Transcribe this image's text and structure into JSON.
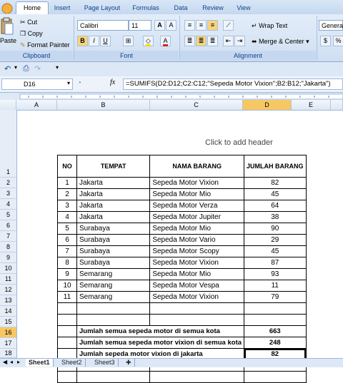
{
  "ribbon": {
    "tabs": [
      "Home",
      "Insert",
      "Page Layout",
      "Formulas",
      "Data",
      "Review",
      "View"
    ],
    "active_tab": "Home",
    "clipboard": {
      "paste": "Paste",
      "cut": "Cut",
      "copy": "Copy",
      "format_painter": "Format Painter",
      "label": "Clipboard"
    },
    "font": {
      "name": "Calibri",
      "size": "11",
      "label": "Font"
    },
    "alignment": {
      "wrap_text": "Wrap Text",
      "merge_center": "Merge & Center",
      "label": "Alignment"
    },
    "number": {
      "format": "General"
    }
  },
  "formula_bar": {
    "cell_ref": "D16",
    "fx": "fx",
    "formula": "=SUMIFS(D2:D12;C2:C12;\"Sepeda Motor Vixion\";B2:B12;\"Jakarta\")"
  },
  "columns": [
    "A",
    "B",
    "C",
    "D",
    "E"
  ],
  "selected_column": "D",
  "rows": [
    "1",
    "2",
    "3",
    "4",
    "5",
    "6",
    "7",
    "8",
    "9",
    "10",
    "11",
    "12",
    "13",
    "14",
    "15",
    "16",
    "17",
    "18"
  ],
  "selected_row": "16",
  "page_header_placeholder": "Click to add header",
  "table": {
    "headers": [
      "NO",
      "TEMPAT",
      "NAMA BARANG",
      "JUMLAH BARANG"
    ],
    "rows": [
      [
        "1",
        "Jakarta",
        "Sepeda Motor Vixion",
        "82"
      ],
      [
        "2",
        "Jakarta",
        "Sepeda Motor Mio",
        "45"
      ],
      [
        "3",
        "Jakarta",
        "Sepeda Motor Verza",
        "64"
      ],
      [
        "4",
        "Jakarta",
        "Sepeda Motor Jupiter",
        "38"
      ],
      [
        "5",
        "Surabaya",
        "Sepeda Motor Mio",
        "90"
      ],
      [
        "6",
        "Surabaya",
        "Sepeda Motor Vario",
        "29"
      ],
      [
        "7",
        "Surabaya",
        "Sepeda Motor Scopy",
        "45"
      ],
      [
        "8",
        "Surabaya",
        "Sepeda Motor Vixion",
        "87"
      ],
      [
        "9",
        "Semarang",
        "Sepeda Motor Mio",
        "93"
      ],
      [
        "10",
        "Semarang",
        "Sepeda Motor Vespa",
        "11"
      ],
      [
        "11",
        "Semarang",
        "Sepeda Motor Vixion",
        "79"
      ]
    ],
    "summary": [
      {
        "label": "Jumlah semua sepeda motor di semua kota",
        "value": "663"
      },
      {
        "label": "Jumlah semua sepeda motor vixion di semua kota",
        "value": "248"
      },
      {
        "label": "Jumlah sepeda motor vixion di jakarta",
        "value": "82"
      }
    ]
  },
  "sheets": [
    "Sheet1",
    "Sheet2",
    "Sheet3"
  ],
  "active_sheet": "Sheet1",
  "colors": {
    "accent": "#15428b",
    "selected_header": "#f6c763",
    "ribbon_bg": "#d9e6f6"
  }
}
